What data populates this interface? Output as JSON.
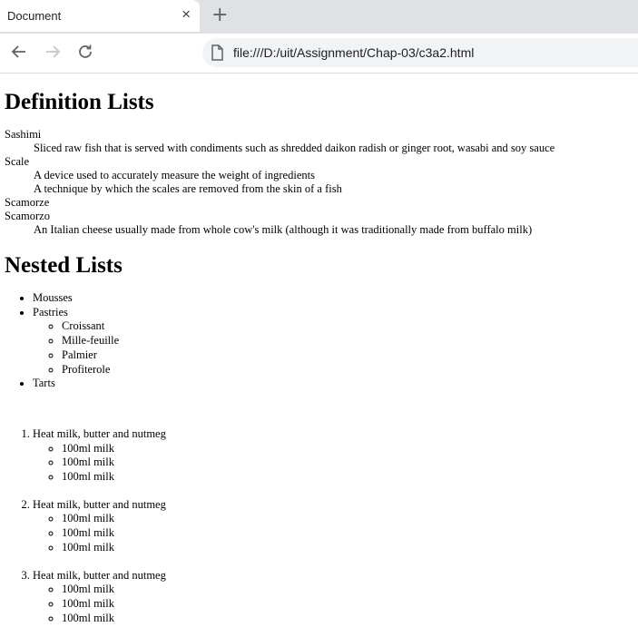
{
  "browser": {
    "tab_title": "Document",
    "close_glyph": "×",
    "newtab_glyph": "+",
    "url": "file:///D:/uit/Assignment/Chap-03/c3a2.html"
  },
  "page": {
    "heading1": "Definition Lists",
    "definitions": {
      "t1": "Sashimi",
      "d1": "Sliced raw fish that is served with condiments such as shredded daikon radish or ginger root, wasabi and soy sauce",
      "t2": "Scale",
      "d2": "A device used to accurately measure the weight of ingredients",
      "d3": "A technique by which the scales are removed from the skin of a fish",
      "t3": "Scamorze",
      "t4": "Scamorzo",
      "d4": "An Italian cheese usually made from whole cow's milk (although it was traditionally made from buffalo milk)"
    },
    "heading2": "Nested Lists",
    "ul": {
      "i1": "Mousses",
      "i2": "Pastries",
      "sub": [
        "Croissant",
        "Mille-feuille",
        "Palmier",
        "Profiterole"
      ],
      "i3": "Tarts"
    },
    "ol": {
      "step": "Heat milk, butter and nutmeg",
      "sub": [
        "100ml milk",
        "100ml milk",
        "100ml milk"
      ]
    }
  }
}
